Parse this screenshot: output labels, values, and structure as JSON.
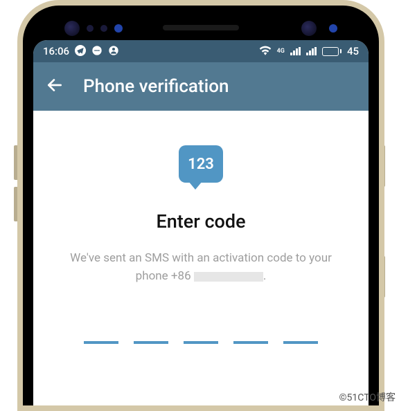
{
  "status": {
    "time": "16:06",
    "battery_pct": "45",
    "network_label": "4G"
  },
  "appbar": {
    "title": "Phone verification"
  },
  "content": {
    "badge_text": "123",
    "heading": "Enter code",
    "desc_part1": "We've sent an SMS with an activation code to your phone +86",
    "desc_part2": "."
  },
  "watermark": "©51CTO博客"
}
